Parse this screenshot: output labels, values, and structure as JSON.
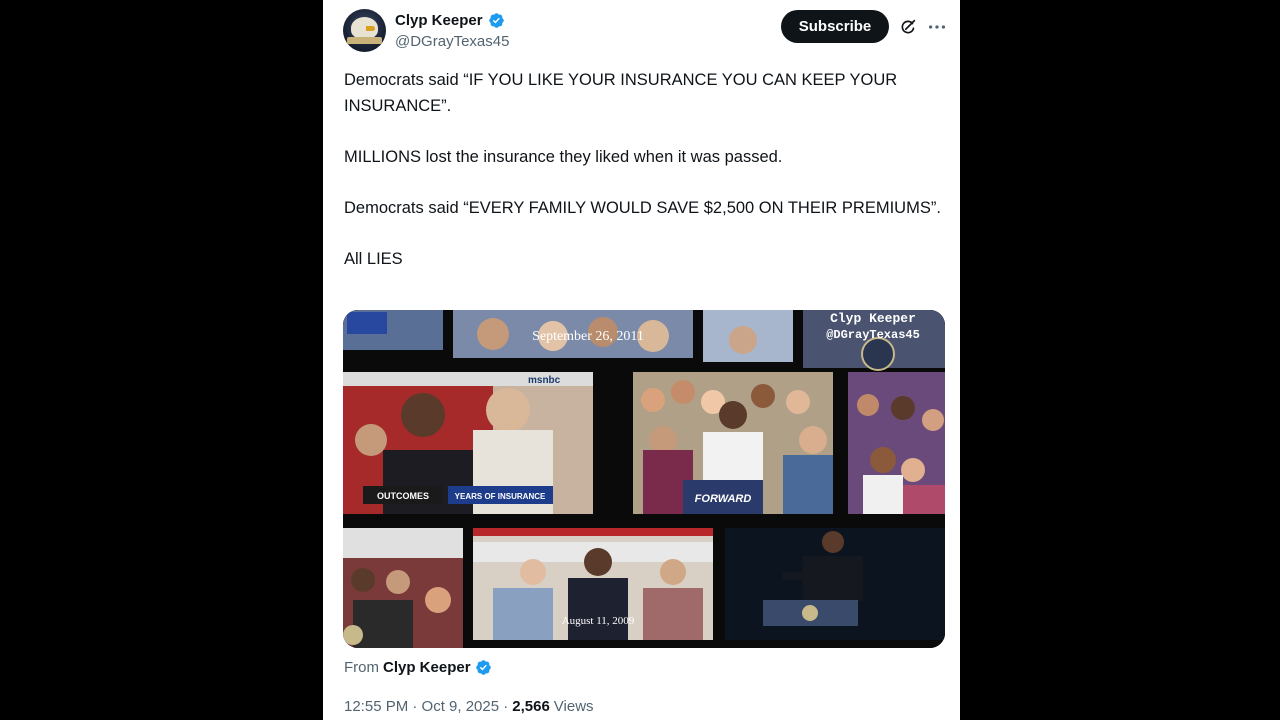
{
  "author": {
    "display_name": "Clyp Keeper",
    "handle": "@DGrayTexas45",
    "avatar_icon": "eagle-avatar-icon",
    "verified_icon": "verified-badge-icon",
    "verified_color": "#1d9bf0"
  },
  "actions": {
    "subscribe_label": "Subscribe",
    "grok_icon": "grok-icon",
    "more_icon": "more-icon"
  },
  "tweet": {
    "paragraphs": [
      "Democrats said “IF YOU LIKE YOUR INSURANCE YOU CAN KEEP YOUR INSURANCE”.",
      "MILLIONS lost the insurance they liked when it was passed.",
      "Democrats said “EVERY FAMILY WOULD SAVE $2,500 ON THEIR PREMIUMS”.",
      "All LIES"
    ]
  },
  "media": {
    "watermark_name": "Clyp Keeper",
    "watermark_handle": "@DGrayTexas45",
    "caption_top": "September 26, 2011",
    "caption_bottom": "August 11, 2009",
    "podium_sign": "FORWARD",
    "news_ticker": "YEARS OF INSURANCE",
    "news_banner": "OUTCOMES",
    "news_logo": "msnbc"
  },
  "footer": {
    "from_label": "From",
    "from_name": "Clyp Keeper",
    "timestamp": "12:55 PM · Oct 9, 2025 ·",
    "views_count": "2,566",
    "views_label": "Views"
  }
}
